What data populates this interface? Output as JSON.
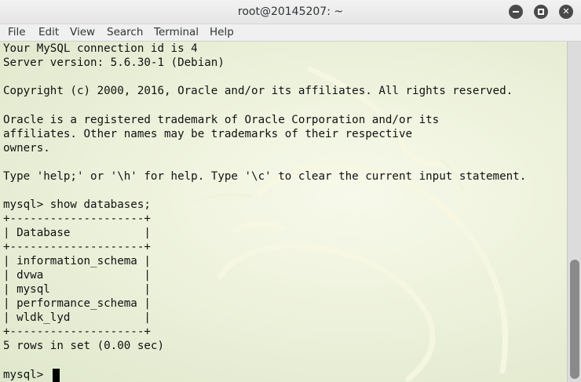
{
  "window": {
    "title": "root@20145207: ~"
  },
  "menu": [
    "File",
    "Edit",
    "View",
    "Search",
    "Terminal",
    "Help"
  ],
  "terminal": {
    "lines": [
      "Your MySQL connection id is 4",
      "Server version: 5.6.30-1 (Debian)",
      "",
      "Copyright (c) 2000, 2016, Oracle and/or its affiliates. All rights reserved.",
      "",
      "Oracle is a registered trademark of Oracle Corporation and/or its",
      "affiliates. Other names may be trademarks of their respective",
      "owners.",
      "",
      "Type 'help;' or '\\h' for help. Type '\\c' to clear the current input statement.",
      "",
      "mysql> show databases;",
      "+--------------------+",
      "| Database           |",
      "+--------------------+",
      "| information_schema |",
      "| dvwa               |",
      "| mysql              |",
      "| performance_schema |",
      "| wldk_lyd           |",
      "+--------------------+",
      "5 rows in set (0.00 sec)",
      "",
      "mysql> "
    ]
  },
  "scrollbar": {
    "position_fraction": 1.0
  }
}
